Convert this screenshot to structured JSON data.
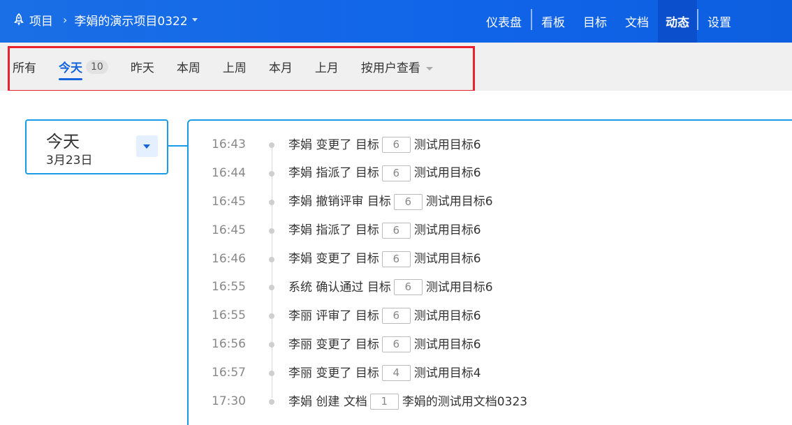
{
  "breadcrumb": {
    "root": "项目",
    "project": "李娟的演示项目0322"
  },
  "nav": {
    "items": [
      {
        "label": "仪表盘"
      },
      {
        "label": "看板"
      },
      {
        "label": "目标"
      },
      {
        "label": "文档"
      },
      {
        "label": "动态"
      },
      {
        "label": "设置"
      }
    ],
    "active": "动态"
  },
  "filters": {
    "all": "所有",
    "today": "今天",
    "today_count": "10",
    "yesterday": "昨天",
    "this_week": "本周",
    "last_week": "上周",
    "this_month": "本月",
    "last_month": "上月",
    "by_user": "按用户查看"
  },
  "day": {
    "title": "今天",
    "date": "3月23日"
  },
  "events": [
    {
      "time": "16:43",
      "user": "李娟",
      "action": "变更了",
      "type": "目标",
      "num": "6",
      "name": "测试用目标6"
    },
    {
      "time": "16:44",
      "user": "李娟",
      "action": "指派了",
      "type": "目标",
      "num": "6",
      "name": "测试用目标6"
    },
    {
      "time": "16:45",
      "user": "李娟",
      "action": "撤销评审",
      "type": "目标",
      "num": "6",
      "name": "测试用目标6"
    },
    {
      "time": "16:45",
      "user": "李娟",
      "action": "指派了",
      "type": "目标",
      "num": "6",
      "name": "测试用目标6"
    },
    {
      "time": "16:46",
      "user": "李娟",
      "action": "变更了",
      "type": "目标",
      "num": "6",
      "name": "测试用目标6"
    },
    {
      "time": "16:55",
      "user": "系统",
      "action": "确认通过",
      "type": "目标",
      "num": "6",
      "name": "测试用目标6"
    },
    {
      "time": "16:55",
      "user": "李丽",
      "action": "评审了",
      "type": "目标",
      "num": "6",
      "name": "测试用目标6"
    },
    {
      "time": "16:56",
      "user": "李丽",
      "action": "变更了",
      "type": "目标",
      "num": "6",
      "name": "测试用目标6"
    },
    {
      "time": "16:57",
      "user": "李丽",
      "action": "变更了",
      "type": "目标",
      "num": "4",
      "name": "测试用目标4"
    },
    {
      "time": "17:30",
      "user": "李娟",
      "action": "创建",
      "type": "文档",
      "num": "1",
      "name": "李娟的测试用文档0323"
    }
  ],
  "colors": {
    "topbar": "#1064e8",
    "active_nav": "#0b4fcc",
    "accent": "#1465dc",
    "card_border": "#1a9be8",
    "highlight": "#e8212e"
  },
  "icons": {
    "logo": "rocket-icon",
    "breadcrumb_separator": "chevron-right-icon",
    "project_dropdown": "caret-down-icon",
    "user_filter_dropdown": "caret-down-icon",
    "date_toggle": "caret-down-icon"
  }
}
